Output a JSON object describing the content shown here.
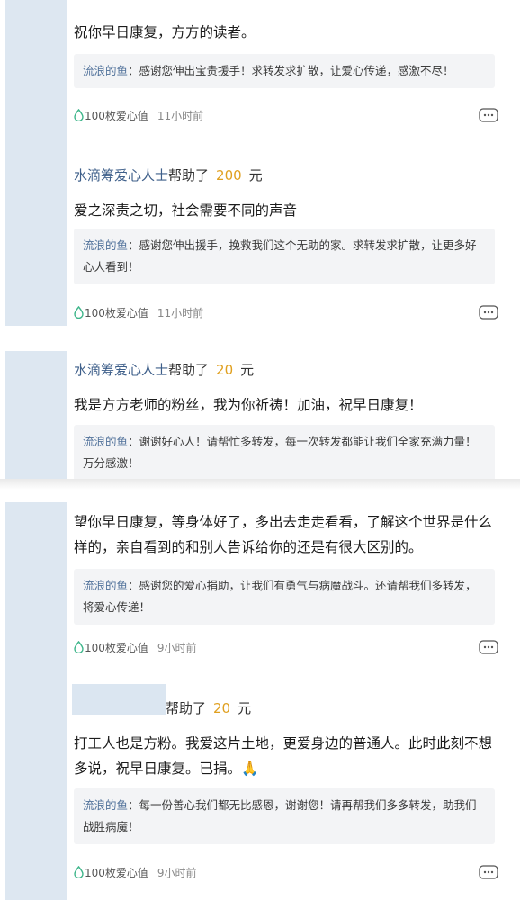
{
  "comments": [
    {
      "text": "祝你早日康复，方方的读者。",
      "reply_name": "流浪的鱼",
      "reply_text": "：感谢您伸出宝贵援手！求转发求扩散，让爱心传递，感激不尽！",
      "points": "100枚爱心值",
      "time": "11小时前"
    },
    {
      "helper_user": "水滴筹爱心人士",
      "helper_action": "帮助了",
      "amount": "200",
      "unit": "元",
      "text": "爱之深责之切，社会需要不同的声音",
      "reply_name": "流浪的鱼",
      "reply_text": "：感谢您伸出援手，挽救我们这个无助的家。求转发求扩散，让更多好心人看到！",
      "points": "100枚爱心值",
      "time": "11小时前"
    },
    {
      "helper_user": "水滴筹爱心人士",
      "helper_action": "帮助了",
      "amount": "20",
      "unit": "元",
      "text": "我是方方老师的粉丝，我为你祈祷！加油，祝早日康复！",
      "reply_name": "流浪的鱼",
      "reply_text": "：谢谢好心人！请帮忙多转发，每一次转发都能让我们全家充满力量！万分感激！"
    },
    {
      "text": "望你早日康复，等身体好了，多出去走走看看，了解这个世界是什么样的，亲自看到的和别人告诉给你的还是有很大区别的。",
      "reply_name": "流浪的鱼",
      "reply_text": "：感谢您的爱心捐助，让我们有勇气与病魔战斗。还请帮我们多转发，将爱心传递！",
      "points": "100枚爱心值",
      "time": "9小时前"
    },
    {
      "helper_action": "帮助了",
      "amount": "20",
      "unit": "元",
      "text": "打工人也是方粉。我爱这片土地，更爱身边的普通人。此时此刻不想多说，祝早日康复。已捐。🙏",
      "reply_name": "流浪的鱼",
      "reply_text": "：每一份善心我们都无比感恩，谢谢您！请再帮我们多多转发，助我们战胜病魔！",
      "points": "100枚爱心值",
      "time": "9小时前"
    }
  ],
  "icons": {
    "drop": "water-drop-icon",
    "more": "comment-more-icon"
  },
  "colors": {
    "accent_blue": "#3e5f8a",
    "amount": "#e0a020",
    "drop_green": "#3fb68b",
    "reply_bg": "#f3f4f6"
  }
}
